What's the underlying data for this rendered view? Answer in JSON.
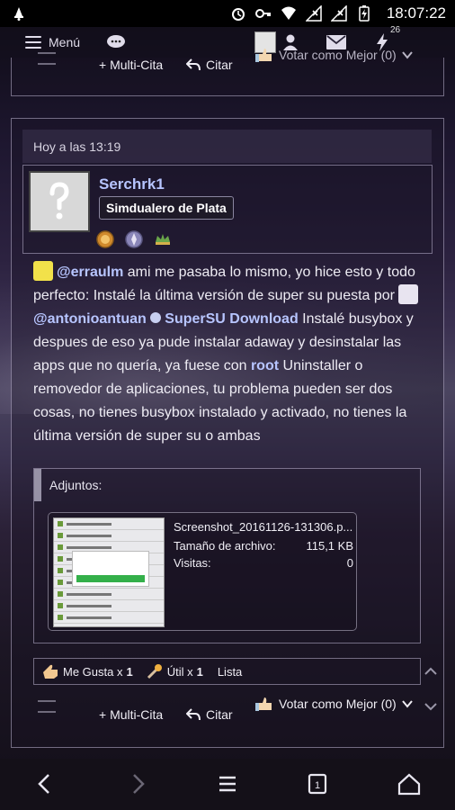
{
  "status_bar": {
    "time": "18:07:22"
  },
  "topbar": {
    "menu_label": "Menú",
    "notification_count": "26"
  },
  "prev_post": {
    "multiquote_label": "+ Multi-Cita",
    "quote_label": "Citar",
    "vote_label": "Votar como Mejor (0)"
  },
  "post": {
    "date": "Hoy a las 13:19",
    "username": "Serchrk1",
    "rank": "Simdualero de Plata",
    "message": {
      "mention1": "@erraulm",
      "text1": " ami me pasaba lo mismo, yo hice esto y todo perfecto: Instalé la última versión de super su puesta por ",
      "mention2": "@antonioantuan",
      "link_supersu": "SuperSU Download",
      "text2": " Instalé busybox y despues de eso ya pude instalar adaway y desinstalar las apps que no quería, ya fuese con ",
      "link_root": "root",
      "text3": " Uninstaller o removedor de aplicaciones, tu problema pueden ser dos cosas, no tienes busybox instalado y activado, no tienes la última versión de super su o ambas"
    },
    "attachments": {
      "title": "Adjuntos:",
      "file": {
        "name": "Screenshot_20161126-131306.p...",
        "size_label": "Tamaño de archivo:",
        "size_value": "115,1 KB",
        "visits_label": "Visitas:",
        "visits_value": "0"
      }
    },
    "reactions": {
      "like_label": "Me Gusta x",
      "like_count": "1",
      "useful_label": "Útil x",
      "useful_count": "1",
      "list_label": "Lista"
    },
    "actions": {
      "multiquote_label": "+ Multi-Cita",
      "quote_label": "Citar",
      "vote_label": "Votar como Mejor (0)"
    }
  },
  "colors": {
    "mention": "#b7c5ff",
    "border": "#b4aad2",
    "statusbar": "#000000"
  },
  "icons": [
    "menu-icon",
    "chat-icon",
    "user-icon",
    "mail-icon",
    "bolt-icon",
    "quote-icon",
    "like-icon",
    "wrench-icon",
    "vote-hand-icon",
    "back-icon",
    "forward-icon",
    "tabs-icon",
    "home-icon"
  ]
}
